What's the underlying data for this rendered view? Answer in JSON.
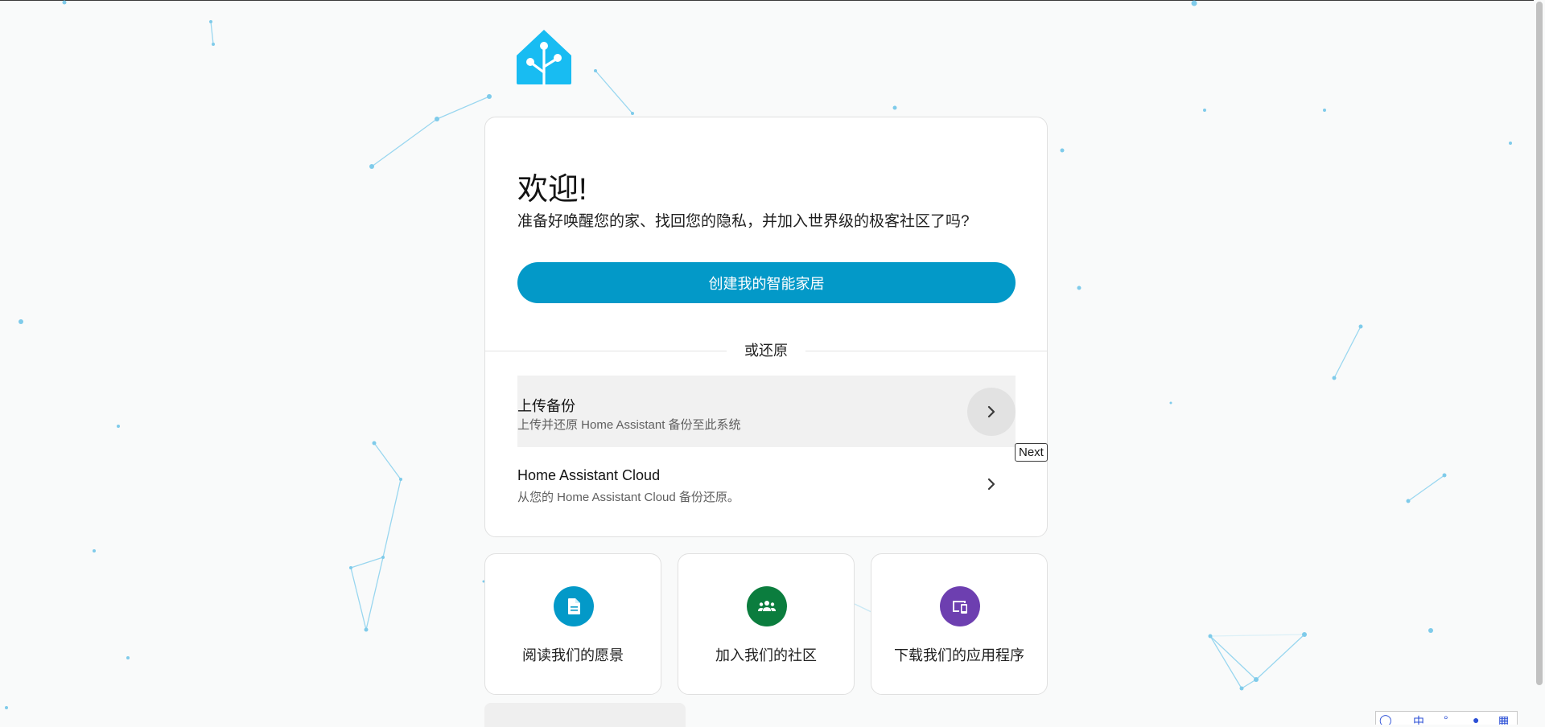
{
  "welcome": {
    "title": "欢迎!",
    "subtitle": "准备好唤醒您的家、找回您的隐私，并加入世界级的极客社区了吗?",
    "create_button": "创建我的智能家居"
  },
  "restore": {
    "divider_label": "或还原",
    "options": [
      {
        "title": "上传备份",
        "description": "上传并还原 Home Assistant 备份至此系统"
      },
      {
        "title": "Home Assistant Cloud",
        "description": "从您的 Home Assistant Cloud 备份还原。"
      }
    ]
  },
  "tooltip": "Next",
  "links": [
    {
      "label": "阅读我们的愿景",
      "icon": "document-icon",
      "color": "#0399c8"
    },
    {
      "label": "加入我们的社区",
      "icon": "community-icon",
      "color": "#0b7d3e"
    },
    {
      "label": "下载我们的应用程序",
      "icon": "devices-icon",
      "color": "#6d3fb0"
    }
  ],
  "ime_toolbar": {
    "mode": "中"
  },
  "colors": {
    "brand": "#18bcf2",
    "primary_button": "#0399c8",
    "network_lines": "#8fd3ee"
  }
}
